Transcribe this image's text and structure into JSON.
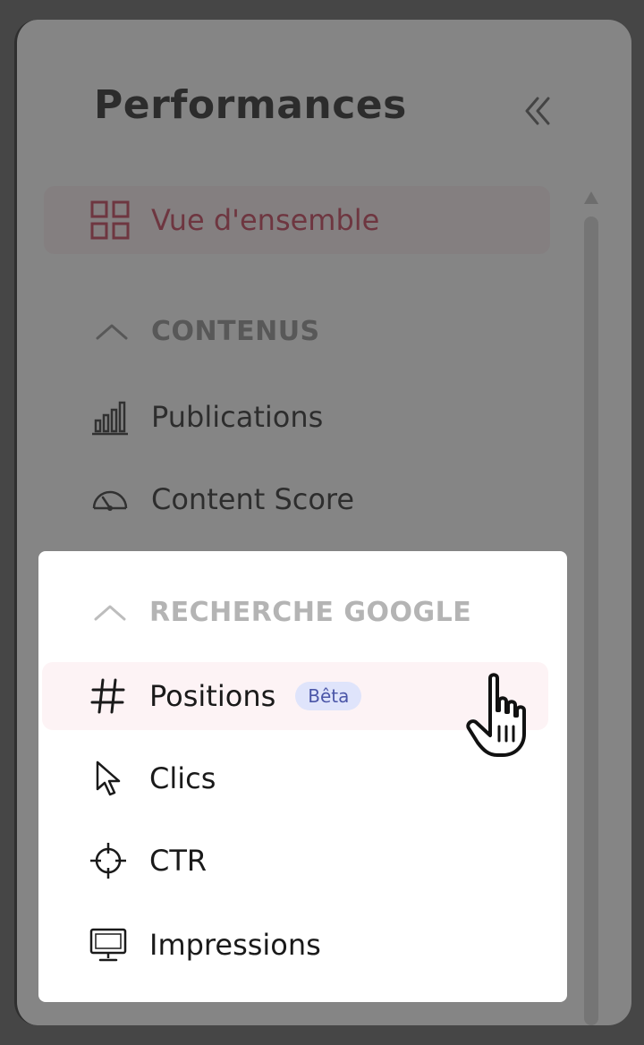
{
  "sidebar": {
    "title": "Performances",
    "collapse_icon": "double-chevron-left-icon",
    "overview": {
      "label": "Vue d'ensemble",
      "icon": "grid-icon"
    },
    "sections": [
      {
        "label": "CONTENUS",
        "icon": "chevron-up-icon",
        "items": [
          {
            "label": "Publications",
            "icon": "bar-chart-icon"
          },
          {
            "label": "Content Score",
            "icon": "gauge-icon"
          }
        ]
      },
      {
        "label": "RECHERCHE GOOGLE",
        "icon": "chevron-up-icon",
        "items": [
          {
            "label": "Positions",
            "icon": "hash-icon",
            "badge": "Bêta"
          },
          {
            "label": "Clics",
            "icon": "cursor-arrow-icon"
          },
          {
            "label": "CTR",
            "icon": "crosshair-icon"
          },
          {
            "label": "Impressions",
            "icon": "monitor-icon"
          }
        ]
      }
    ]
  },
  "colors": {
    "accent": "#c2304b",
    "active_bg": "#fdeef1",
    "badge_bg": "#dfe4fb",
    "badge_text": "#4b56a8",
    "backdrop": "#5b5b5b"
  },
  "pointer_icon": "hand-pointer-icon"
}
